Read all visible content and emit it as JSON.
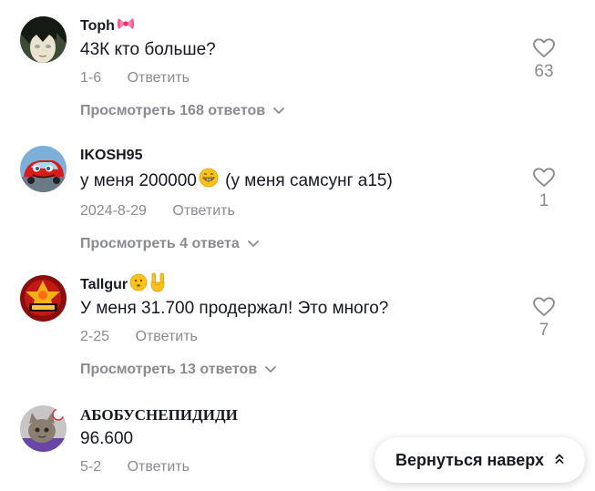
{
  "comments": [
    {
      "username": "Toph",
      "text": "43К кто больше?",
      "date": "1-6",
      "reply_label": "Ответить",
      "likes": "63",
      "view_replies": "Просмотреть 168 ответов",
      "emoji": "ribbon-bow"
    },
    {
      "username": "IKOSH95",
      "text_before": "у меня 200000",
      "text_after": " (у меня самсунг а15)",
      "emoji": "grinning-face",
      "date": "2024-8-29",
      "reply_label": "Ответить",
      "likes": "1",
      "view_replies": "Просмотреть 4 ответа"
    },
    {
      "username": "Tallgur",
      "text": "У меня 31.700 продержал! Это много?",
      "date": "2-25",
      "reply_label": "Ответить",
      "likes": "7",
      "view_replies": "Просмотреть 13 ответов",
      "emojis": [
        "hushed-face",
        "rock-hand"
      ]
    },
    {
      "username": "АБОБУСНЕПИДИДИ",
      "text": "96.600",
      "date": "5-2",
      "reply_label": "Ответить"
    }
  ],
  "back_to_top": {
    "label": "Вернуться наверх"
  },
  "colors": {
    "primary_text": "#161823",
    "secondary_text": "#8a8b91",
    "background": "#ffffff"
  }
}
